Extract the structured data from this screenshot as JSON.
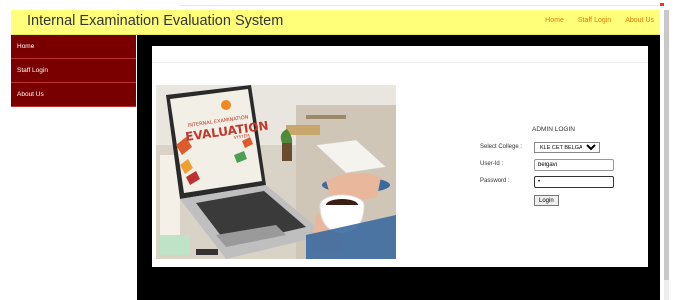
{
  "header": {
    "title": "Internal Examination Evaluation System",
    "nav": [
      "Home",
      "Staff Login",
      "About Us"
    ]
  },
  "sidebar": {
    "items": [
      {
        "label": "Home"
      },
      {
        "label": "Staff Login"
      },
      {
        "label": "About Us"
      }
    ]
  },
  "hero": {
    "screen_title": "EVALUATION",
    "screen_subtitle": "INTERNAL EXAMINATION",
    "screen_footer": "SYSTEM"
  },
  "login": {
    "heading": "ADMIN LOGIN",
    "college_label": "Select College :",
    "college_value": "KLE CET BELGAVI",
    "userid_label": "User-Id :",
    "userid_value": "belgavi",
    "password_label": "Password :",
    "password_value": "•",
    "button_label": "Login"
  },
  "colors": {
    "header_bg": "#ffff7a",
    "sidebar_bg": "#7a0000",
    "nav_link": "#e07a00",
    "main_bg": "#000000"
  }
}
